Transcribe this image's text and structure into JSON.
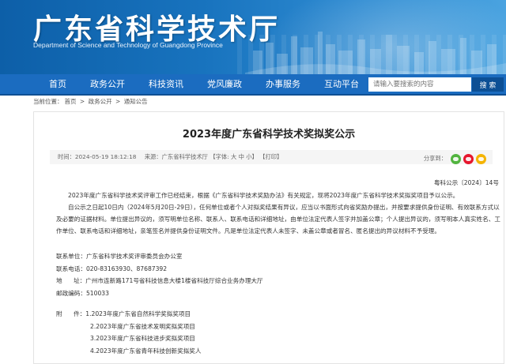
{
  "header": {
    "title": "广东省科学技术厅",
    "subtitle": "Department of Science and Technology of Guangdong Province"
  },
  "nav": {
    "items": [
      "首页",
      "政务公开",
      "科技资讯",
      "党风廉政",
      "办事服务",
      "互动平台"
    ],
    "search_placeholder": "请输入要搜索的内容",
    "search_button": "搜 索"
  },
  "breadcrumb": {
    "prefix": "当前位置：",
    "items": [
      "首页",
      "政务公开",
      "通知公告"
    ],
    "separator": ">"
  },
  "article": {
    "title": "2023年度广东省科学技术奖拟奖公示",
    "meta": {
      "time_label": "时间：",
      "time": "2024-05-19 18:12:18",
      "source_label": "来源：",
      "source": "广东省科学技术厅",
      "font_label": "【字体:",
      "font_large": "大",
      "font_medium": "中",
      "font_small": "小",
      "font_close": "】",
      "print": "【打印】",
      "share_label": "分享到："
    },
    "doc_number": "粤科公示〔2024〕14号",
    "paragraphs": [
      "2023年度广东省科学技术奖评审工作已经结束，根据《广东省科学技术奖励办法》有关规定，现将2023年度广东省科学技术奖拟奖项目予以公示。",
      "自公示之日起10日内（2024年5月20日-29日），任何单位或者个人对拟奖结果有异议，应当以书面形式向省奖励办提出，并按要求提供身份证明、有效联系方式以及必要的证据材料。单位提出异议的，须写明单位名称、联系人、联系电话和详细地址，由单位法定代表人签字并加盖公章；个人提出异议的，须写明本人真实姓名、工作单位、联系电话和详细地址，亲笔签名并提供身份证明文件。凡是单位法定代表人未签字、未盖公章或者冒名、匿名提出的异议材料不予受理。"
    ],
    "contact": {
      "unit_label": "联系单位：",
      "unit": "广东省科学技术奖评审委员会办公室",
      "phone_label": "联系电话：",
      "phone": "020-83163930、87687392",
      "address_label": "地      址：",
      "address": "广州市连新路171号省科技信息大楼1楼省科技厅综合业务办理大厅",
      "postcode_label": "邮政编码：",
      "postcode": "510033"
    },
    "attachments": {
      "label": "附      件：",
      "items": [
        "1.2023年度广东省自然科学奖拟奖项目",
        "2.2023年度广东省技术发明奖拟奖项目",
        "3.2023年度广东省科技进步奖拟奖项目",
        "4.2023年度广东省青年科技创新奖拟奖人"
      ]
    }
  }
}
